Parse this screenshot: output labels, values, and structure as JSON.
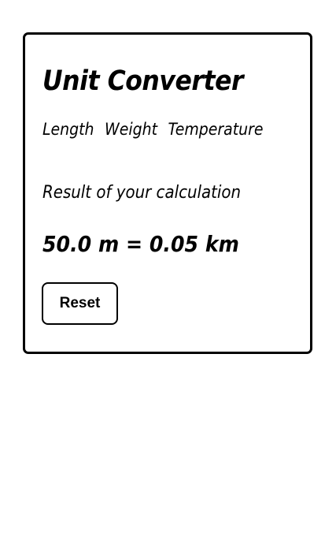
{
  "app": {
    "title": "Unit Converter"
  },
  "nav": {
    "items": [
      {
        "label": "Length"
      },
      {
        "label": "Weight"
      },
      {
        "label": "Temperature"
      }
    ]
  },
  "result": {
    "label": "Result of your calculation",
    "value": "50.0 m = 0.05 km"
  },
  "actions": {
    "reset_label": "Reset"
  },
  "colors": {
    "border": "#000000",
    "background": "#ffffff",
    "text": "#000000"
  }
}
